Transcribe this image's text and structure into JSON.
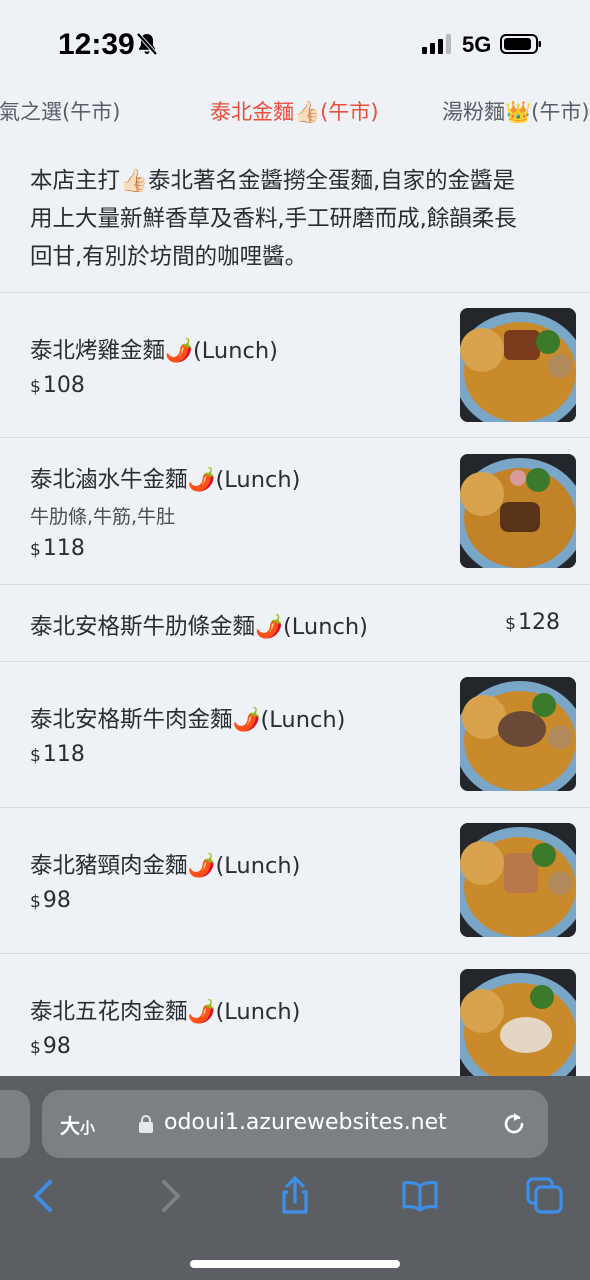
{
  "status_bar": {
    "time": "12:39",
    "network": "5G",
    "icons": [
      "bell-slash-icon",
      "signal-bars-icon",
      "battery-icon"
    ]
  },
  "tabs": [
    {
      "label": "人氣之選(午市)",
      "active": false
    },
    {
      "label": "泰北金麵👍🏻(午市)",
      "active": true
    },
    {
      "label": "湯粉麵👑(午市)",
      "active": false
    }
  ],
  "intro": {
    "lines": [
      "本店主打👍🏻泰北著名金醬撈全蛋麵,自家的金醬是",
      "用上大量新鮮香草及香料,手工研磨而成,餘韻柔長",
      "回甘,有別於坊間的咖哩醬。"
    ]
  },
  "menu": {
    "currency": "$",
    "items": [
      {
        "name": "泰北烤雞金麵🌶️(Lunch)",
        "description": "",
        "price": "108",
        "has_image": true
      },
      {
        "name": "泰北滷水牛金麵🌶️(Lunch)",
        "description": "牛肋條,牛筋,牛肚",
        "price": "118",
        "has_image": true
      },
      {
        "name": "泰北安格斯牛肋條金麵🌶️(Lunch)",
        "description": "",
        "price": "128",
        "has_image": false
      },
      {
        "name": "泰北安格斯牛肉金麵🌶️(Lunch)",
        "description": "",
        "price": "118",
        "has_image": true
      },
      {
        "name": "泰北豬頸肉金麵🌶️(Lunch)",
        "description": "",
        "price": "98",
        "has_image": true
      },
      {
        "name": "泰北五花肉金麵🌶️(Lunch)",
        "description": "",
        "price": "98",
        "has_image": true
      }
    ]
  },
  "browser": {
    "text_size_label": "大",
    "text_size_small": "小",
    "url": "odoui1.azurewebsites.net",
    "toolbar_icons": [
      "back-icon",
      "forward-icon",
      "share-icon",
      "bookmarks-icon",
      "tabs-icon"
    ]
  },
  "colors": {
    "accent": "#e8503a",
    "background": "#eef1f5",
    "browser_chrome": "#5b5f63",
    "toolbar_icon": "#3d8fe8"
  }
}
